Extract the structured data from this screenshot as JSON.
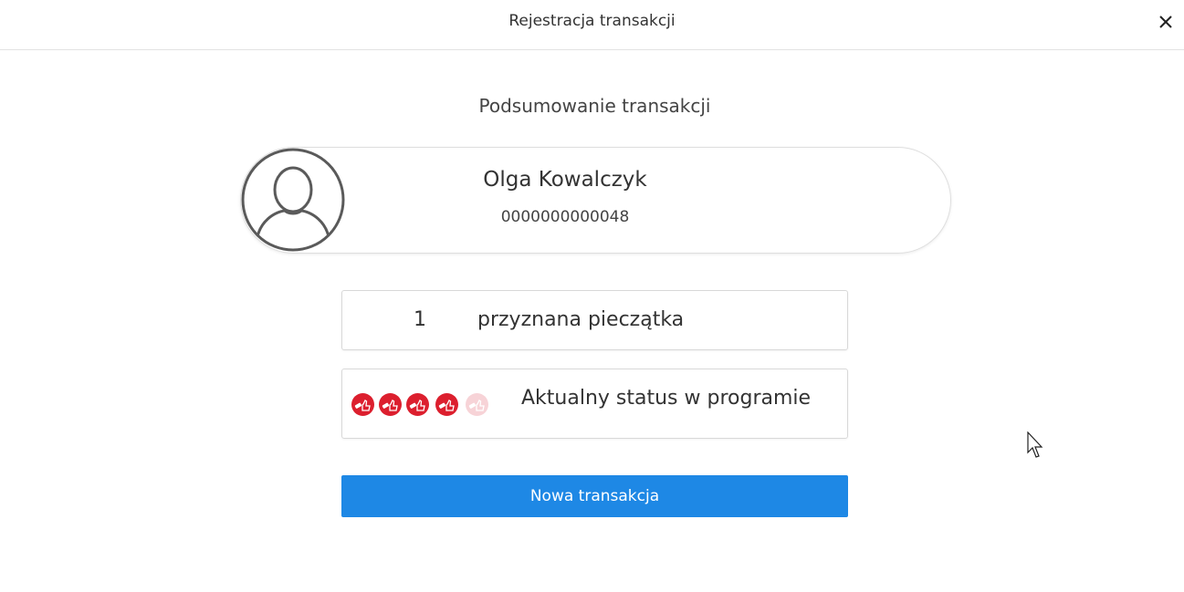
{
  "dialog": {
    "title": "Rejestracja transakcji",
    "close_icon": "close-icon"
  },
  "summary": {
    "title": "Podsumowanie transakcji"
  },
  "customer": {
    "avatar_icon": "user-avatar-icon",
    "name": "Olga Kowalczyk",
    "number": "0000000000048"
  },
  "stamps_awarded": {
    "count": "1",
    "label": "przyznana pieczątka"
  },
  "program_status": {
    "label": "Aktualny status w programie",
    "stamps_total": 5,
    "stamps_collected": 4,
    "stamp_icon": "stamp-thumbs-up-icon",
    "active_color": "#dc1f2e",
    "inactive_color": "#f7d3d7"
  },
  "actions": {
    "new_transaction_label": "Nowa transakcja",
    "button_color": "#1e88e5"
  }
}
